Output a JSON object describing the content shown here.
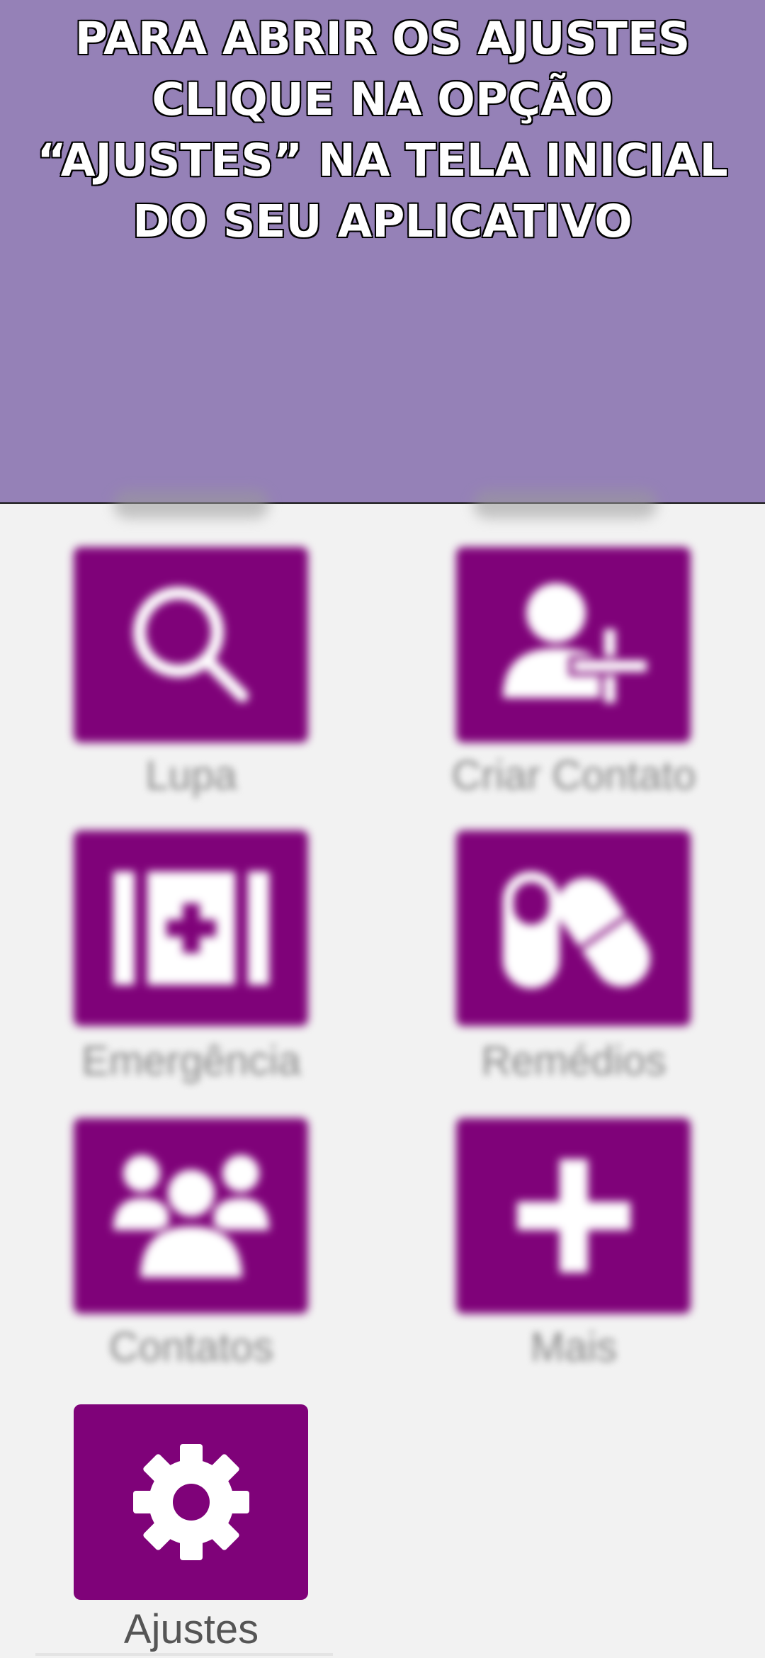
{
  "banner": {
    "lines": [
      "PARA ABRIR OS AJUSTES",
      "CLIQUE NA OPÇÃO",
      "“AJUSTES” NA TELA INICIAL",
      "DO SEU APLICATIVO"
    ],
    "background_color": "#9581b7"
  },
  "theme": {
    "tile_color": "#7f0279",
    "page_background": "#f2f2f2"
  },
  "grid": {
    "tiles": [
      {
        "label": "Lupa",
        "icon": "magnifier-icon",
        "blurred": true
      },
      {
        "label": "Criar Contato",
        "icon": "add-contact-icon",
        "blurred": true
      },
      {
        "label": "Emergência",
        "icon": "first-aid-kit-icon",
        "blurred": true
      },
      {
        "label": "Remédios",
        "icon": "pills-icon",
        "blurred": true
      },
      {
        "label": "Contatos",
        "icon": "contacts-group-icon",
        "blurred": true
      },
      {
        "label": "Mais",
        "icon": "plus-icon",
        "blurred": true
      },
      {
        "label": "Ajustes",
        "icon": "gear-icon",
        "blurred": false
      }
    ]
  }
}
